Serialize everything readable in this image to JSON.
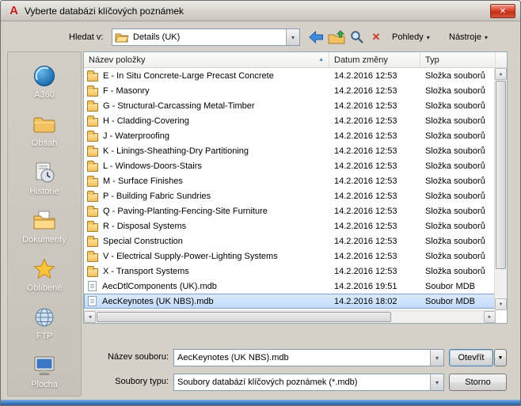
{
  "window": {
    "title": "Vyberte databázi klíčových poznámek",
    "app_icon_text": "A"
  },
  "icons": {
    "close": "✕",
    "combo_arrow": "▾",
    "menu_arrow": "▾",
    "open_menu_arrow": "▼",
    "delete_x": "✕",
    "sort_asc": "▲",
    "scroll_up": "▲",
    "scroll_down": "▼",
    "scroll_left": "◄",
    "scroll_right": "►"
  },
  "toolbar": {
    "look_in_label": "Hledat v:",
    "location": "Details (UK)",
    "views_label": "Pohledy",
    "tools_label": "Nástroje"
  },
  "sidebar": {
    "items": [
      {
        "label": "A360"
      },
      {
        "label": "Obsah"
      },
      {
        "label": "Historie"
      },
      {
        "label": "Dokumenty"
      },
      {
        "label": "Oblíbené"
      },
      {
        "label": "FTP"
      },
      {
        "label": "Plocha"
      }
    ]
  },
  "file_list": {
    "columns": [
      "Název položky",
      "Datum změny",
      "Typ"
    ],
    "rows": [
      {
        "name": "E - In Situ Concrete-Large Precast Concrete",
        "date": "14.2.2016 12:53",
        "type": "Složka souborů",
        "kind": "folder",
        "selected": false
      },
      {
        "name": "F - Masonry",
        "date": "14.2.2016 12:53",
        "type": "Složka souborů",
        "kind": "folder",
        "selected": false
      },
      {
        "name": "G - Structural-Carcassing Metal-Timber",
        "date": "14.2.2016 12:53",
        "type": "Složka souborů",
        "kind": "folder",
        "selected": false
      },
      {
        "name": "H - Cladding-Covering",
        "date": "14.2.2016 12:53",
        "type": "Složka souborů",
        "kind": "folder",
        "selected": false
      },
      {
        "name": "J - Waterproofing",
        "date": "14.2.2016 12:53",
        "type": "Složka souborů",
        "kind": "folder",
        "selected": false
      },
      {
        "name": "K - Linings-Sheathing-Dry Partitioning",
        "date": "14.2.2016 12:53",
        "type": "Složka souborů",
        "kind": "folder",
        "selected": false
      },
      {
        "name": "L - Windows-Doors-Stairs",
        "date": "14.2.2016 12:53",
        "type": "Složka souborů",
        "kind": "folder",
        "selected": false
      },
      {
        "name": "M - Surface Finishes",
        "date": "14.2.2016 12:53",
        "type": "Složka souborů",
        "kind": "folder",
        "selected": false
      },
      {
        "name": "P - Building Fabric Sundries",
        "date": "14.2.2016 12:53",
        "type": "Složka souborů",
        "kind": "folder",
        "selected": false
      },
      {
        "name": "Q - Paving-Planting-Fencing-Site Furniture",
        "date": "14.2.2016 12:53",
        "type": "Složka souborů",
        "kind": "folder",
        "selected": false
      },
      {
        "name": "R - Disposal Systems",
        "date": "14.2.2016 12:53",
        "type": "Složka souborů",
        "kind": "folder",
        "selected": false
      },
      {
        "name": "Special Construction",
        "date": "14.2.2016 12:53",
        "type": "Složka souborů",
        "kind": "folder",
        "selected": false
      },
      {
        "name": "V - Electrical Supply-Power-Lighting Systems",
        "date": "14.2.2016 12:53",
        "type": "Složka souborů",
        "kind": "folder",
        "selected": false
      },
      {
        "name": "X - Transport Systems",
        "date": "14.2.2016 12:53",
        "type": "Složka souborů",
        "kind": "folder",
        "selected": false
      },
      {
        "name": "AecDtlComponents (UK).mdb",
        "date": "14.2.2016 19:51",
        "type": "Soubor MDB",
        "kind": "file",
        "selected": false
      },
      {
        "name": "AecKeynotes (UK NBS).mdb",
        "date": "14.2.2016 18:02",
        "type": "Soubor MDB",
        "kind": "file",
        "selected": true
      }
    ]
  },
  "footer": {
    "file_name_label": "Název souboru:",
    "file_name_value": "AecKeynotes (UK NBS).mdb",
    "file_type_label": "Soubory typu:",
    "file_type_value": "Soubory databází klíčových poznámek (*.mdb)",
    "open_label": "Otevřít",
    "cancel_label": "Storno"
  },
  "colors": {
    "selection_bg": "#c8defb",
    "selection_border": "#7da2ce",
    "close_button": "#c23b2e",
    "folder_yellow": "#f2c260",
    "accent_blue": "#3f8cdc"
  }
}
